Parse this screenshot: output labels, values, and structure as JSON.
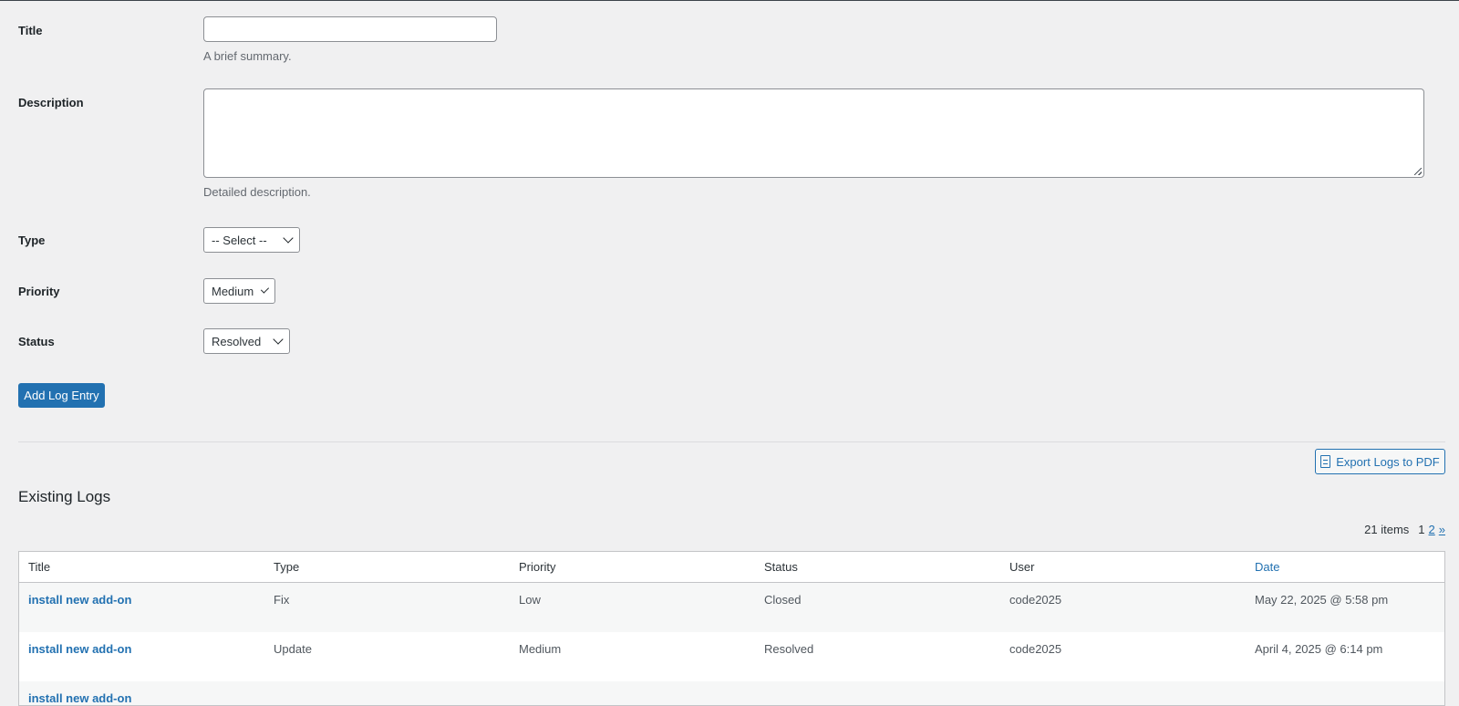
{
  "form": {
    "title_label": "Title",
    "title_value": "",
    "title_hint": "A brief summary.",
    "description_label": "Description",
    "description_value": "",
    "description_hint": "Detailed description.",
    "type_label": "Type",
    "type_value": "-- Select --",
    "priority_label": "Priority",
    "priority_value": "Medium",
    "status_label": "Status",
    "status_value": "Resolved",
    "submit_label": "Add Log Entry"
  },
  "export": {
    "label": "Export Logs to PDF",
    "icon": "document-icon"
  },
  "logs": {
    "heading": "Existing Logs",
    "count": "21 items",
    "pages": {
      "current": "1",
      "next": "2",
      "next_arrow": "»"
    },
    "columns": [
      "Title",
      "Type",
      "Priority",
      "Status",
      "User",
      "Date"
    ],
    "rows": [
      [
        "install new add-on",
        "Fix",
        "Low",
        "Closed",
        "code2025",
        "May 22, 2025 @ 5:58 pm"
      ],
      [
        "install new add-on",
        "Update",
        "Medium",
        "Resolved",
        "code2025",
        "April 4, 2025 @ 6:14 pm"
      ],
      [
        "install new add-on",
        "",
        "",
        "",
        "",
        ""
      ]
    ]
  },
  "colors": {
    "accent": "#2271b1",
    "background": "#f0f0f1"
  }
}
